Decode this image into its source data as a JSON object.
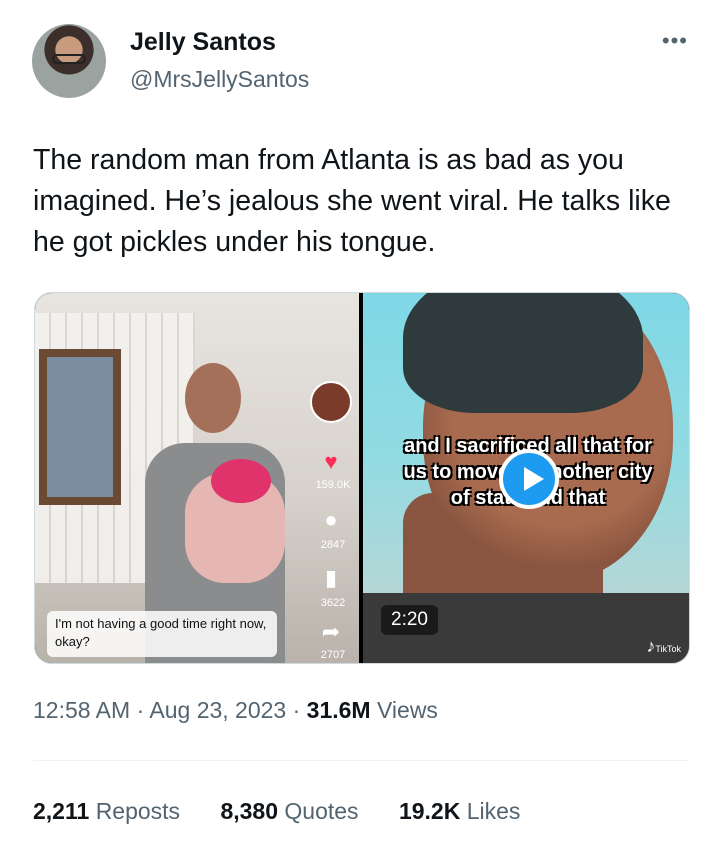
{
  "author": {
    "name": "Jelly Santos",
    "handle": "@MrsJellySantos"
  },
  "more_icon": "more-horizontal-icon",
  "tweet": {
    "text": "The random man from Atlanta is as bad as you imagined. He’s jealous she went viral. He talks like he got pickles under his tongue."
  },
  "media": {
    "left_video": {
      "like_count": "159.0K",
      "comment_count": "2847",
      "save_count": "3622",
      "share_count": "2707",
      "caption": "I'm not having a good time right now, okay?"
    },
    "right_video": {
      "subtitle_line1": "and I sacrificed all that for",
      "subtitle_line2": "us to move to another city",
      "subtitle_line3": "of state and that",
      "duration": "2:20",
      "watermark": "TikTok"
    }
  },
  "meta": {
    "time": "12:58 AM",
    "separator": "·",
    "date": "Aug 23, 2023",
    "views_count": "31.6M",
    "views_label": "Views"
  },
  "stats": {
    "reposts_count": "2,211",
    "reposts_label": "Reposts",
    "quotes_count": "8,380",
    "quotes_label": "Quotes",
    "likes_count": "19.2K",
    "likes_label": "Likes"
  },
  "colors": {
    "text_primary": "#0f1419",
    "text_secondary": "#536471",
    "play_button": "#1d9bf0"
  }
}
